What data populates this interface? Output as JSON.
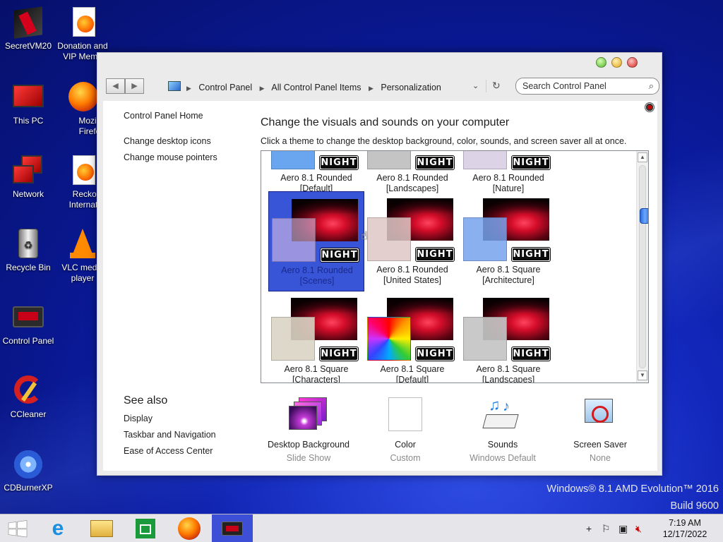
{
  "desktop": {
    "icons": [
      {
        "label": "SecretVM20"
      },
      {
        "label": "Donation and VIP Memb"
      },
      {
        "label": "This PC"
      },
      {
        "label": "Mozilla Firefox"
      },
      {
        "label": "Network"
      },
      {
        "label": "Reckons Internation"
      },
      {
        "label": "Recycle Bin"
      },
      {
        "label": "VLC media player"
      },
      {
        "label": "Control Panel"
      },
      {
        "label": "CCleaner"
      },
      {
        "label": "CDBurnerXP"
      }
    ],
    "watermark_line1": "Windows® 8.1 AMD Evolution™ 2016",
    "watermark_line2": "Build 9600"
  },
  "window": {
    "breadcrumbs": [
      "Control Panel",
      "All Control Panel Items",
      "Personalization"
    ],
    "search_placeholder": "Search Control Panel",
    "sidebar": {
      "home": "Control Panel Home",
      "links": [
        "Change desktop icons",
        "Change mouse pointers"
      ],
      "see_also_title": "See also",
      "see_also": [
        "Display",
        "Taskbar and Navigation",
        "Ease of Access Center"
      ]
    },
    "title": "Change the visuals and sounds on your computer",
    "subtitle": "Click a theme to change the desktop background, color, sounds, and screen saver all at once.",
    "badge_text": "NIGHT",
    "themes": [
      {
        "line1": "Aero 8.1 Rounded",
        "line2": "[Default]"
      },
      {
        "line1": "Aero 8.1 Rounded",
        "line2": "[Landscapes]"
      },
      {
        "line1": "Aero 8.1 Rounded",
        "line2": "[Nature]"
      },
      {
        "line1": "Aero 8.1 Rounded",
        "line2": "[Scenes]"
      },
      {
        "line1": "Aero 8.1 Rounded",
        "line2": "[United States]"
      },
      {
        "line1": "Aero 8.1 Square",
        "line2": "[Architecture]"
      },
      {
        "line1": "Aero 8.1 Square",
        "line2": "[Characters]"
      },
      {
        "line1": "Aero 8.1 Square",
        "line2": "[Default]"
      },
      {
        "line1": "Aero 8.1 Square",
        "line2": "[Landscapes]"
      }
    ],
    "selected_theme": "Aero 8.1 Rounded [Scenes]",
    "personalize": [
      {
        "label": "Desktop Background",
        "value": "Slide Show"
      },
      {
        "label": "Color",
        "value": "Custom"
      },
      {
        "label": "Sounds",
        "value": "Windows Default"
      },
      {
        "label": "Screen Saver",
        "value": "None"
      }
    ]
  },
  "taskbar": {
    "time": "7:19 AM",
    "date": "12/17/2022"
  },
  "colors": {
    "selection": "#3855d8",
    "taskbar_active": "#3c4fd6",
    "desktop": "#1024b8"
  }
}
